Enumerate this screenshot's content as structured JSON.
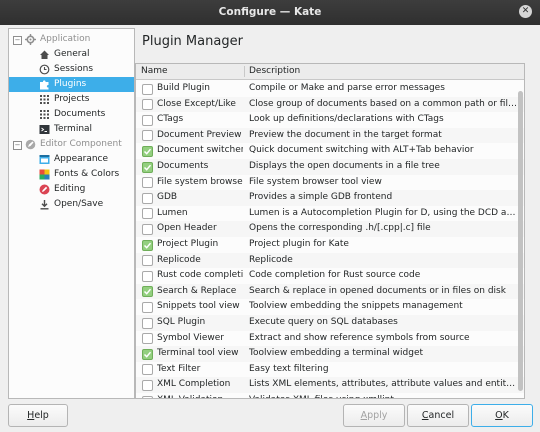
{
  "window": {
    "title": "Configure — Kate",
    "close_glyph": "✕"
  },
  "sidebar": {
    "items": [
      {
        "label": "Application",
        "icon": "gear-icon",
        "type": "category",
        "expander": "−"
      },
      {
        "label": "General",
        "icon": "home-icon",
        "type": "item"
      },
      {
        "label": "Sessions",
        "icon": "clock-icon",
        "type": "item"
      },
      {
        "label": "Plugins",
        "icon": "puzzle-icon",
        "type": "item",
        "selected": true
      },
      {
        "label": "Projects",
        "icon": "grid-icon",
        "type": "item"
      },
      {
        "label": "Documents",
        "icon": "grid-icon",
        "type": "item"
      },
      {
        "label": "Terminal",
        "icon": "terminal-icon",
        "type": "item"
      },
      {
        "label": "Editor Component",
        "icon": "editor-icon",
        "type": "category",
        "expander": "−"
      },
      {
        "label": "Appearance",
        "icon": "appearance-icon",
        "type": "item"
      },
      {
        "label": "Fonts & Colors",
        "icon": "palette-icon",
        "type": "item"
      },
      {
        "label": "Editing",
        "icon": "editing-icon",
        "type": "item"
      },
      {
        "label": "Open/Save",
        "icon": "download-icon",
        "type": "item"
      }
    ]
  },
  "main": {
    "title": "Plugin Manager",
    "columns": {
      "name": "Name",
      "description": "Description"
    },
    "plugins": [
      {
        "name": "Build Plugin",
        "description": "Compile or Make and parse error messages",
        "enabled": false
      },
      {
        "name": "Close Except/Like",
        "description": "Close group of documents based on a common path or file extensi…",
        "enabled": false
      },
      {
        "name": "CTags",
        "description": "Look up definitions/declarations with CTags",
        "enabled": false
      },
      {
        "name": "Document Preview",
        "description": "Preview the document in the target format",
        "enabled": false
      },
      {
        "name": "Document switcher",
        "description": "Quick document switching with ALT+Tab behavior",
        "enabled": true
      },
      {
        "name": "Documents",
        "description": "Displays the open documents in a file tree",
        "enabled": true
      },
      {
        "name": "File system browser",
        "description": "File system browser tool view",
        "enabled": false
      },
      {
        "name": "GDB",
        "description": "Provides a simple GDB frontend",
        "enabled": false
      },
      {
        "name": "Lumen",
        "description": "Lumen is a Autocompletion Plugin for D, using the DCD autocompl…",
        "enabled": false
      },
      {
        "name": "Open Header",
        "description": "Opens the corresponding .h/[.cpp|.c] file",
        "enabled": false
      },
      {
        "name": "Project Plugin",
        "description": "Project plugin for Kate",
        "enabled": true
      },
      {
        "name": "Replicode",
        "description": "Replicode",
        "enabled": false
      },
      {
        "name": "Rust code completion",
        "description": "Code completion for Rust source code",
        "enabled": false
      },
      {
        "name": "Search & Replace",
        "description": "Search & replace in opened documents or in files on disk",
        "enabled": true
      },
      {
        "name": "Snippets tool view",
        "description": "Toolview embedding the snippets management",
        "enabled": false
      },
      {
        "name": "SQL Plugin",
        "description": "Execute query on SQL databases",
        "enabled": false
      },
      {
        "name": "Symbol Viewer",
        "description": "Extract and show reference symbols from source",
        "enabled": false
      },
      {
        "name": "Terminal tool view",
        "description": "Toolview embedding a terminal widget",
        "enabled": true
      },
      {
        "name": "Text Filter",
        "description": "Easy text filtering",
        "enabled": false
      },
      {
        "name": "XML Completion",
        "description": "Lists XML elements, attributes, attribute values and entities allowe…",
        "enabled": false
      },
      {
        "name": "XML Validation",
        "description": "Validates XML files using xmllint",
        "enabled": false
      }
    ]
  },
  "buttons": {
    "help": {
      "mnemonic": "H",
      "rest": "elp"
    },
    "apply": {
      "mnemonic": "A",
      "rest": "pply",
      "disabled": true
    },
    "cancel": {
      "mnemonic": "C",
      "rest": "ancel"
    },
    "ok": {
      "mnemonic": "O",
      "rest": "K"
    }
  },
  "colors": {
    "selection": "#3daee9",
    "checked": "#93cf7f",
    "titlebar": "#2f2f2f"
  }
}
